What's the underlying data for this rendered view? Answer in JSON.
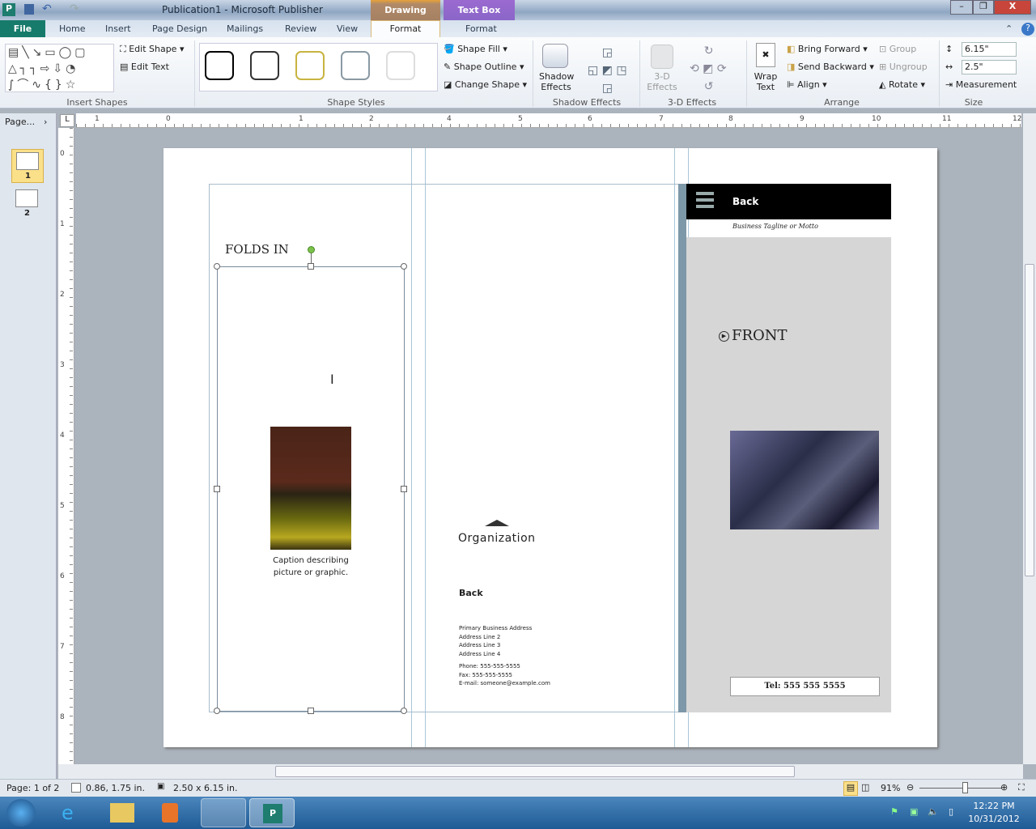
{
  "window": {
    "title": "Publication1  -  Microsoft Publisher"
  },
  "tabs": {
    "file": "File",
    "items": [
      "Home",
      "Insert",
      "Page Design",
      "Mailings",
      "Review",
      "View"
    ],
    "drawing_tools": "Drawing Tools",
    "drawing_format": "Format",
    "textbox_tools": "Text Box Tools",
    "textbox_format": "Format"
  },
  "ribbon": {
    "insert_shapes": {
      "label": "Insert Shapes",
      "edit_shape": "Edit Shape",
      "edit_text": "Edit Text"
    },
    "shape_styles": {
      "label": "Shape Styles",
      "fill": "Shape Fill",
      "outline": "Shape Outline",
      "change": "Change Shape",
      "colors": [
        "#000000",
        "#333333",
        "#c8b440",
        "#8a9aa4",
        "#dddddd"
      ]
    },
    "shadow": {
      "label": "Shadow Effects",
      "button": "Shadow Effects"
    },
    "threed": {
      "label": "3-D Effects",
      "button": "3-D Effects"
    },
    "arrange": {
      "label": "Arrange",
      "wrap": "Wrap Text",
      "bring_forward": "Bring Forward",
      "send_backward": "Send Backward",
      "align": "Align",
      "group": "Group",
      "ungroup": "Ungroup",
      "rotate": "Rotate"
    },
    "size": {
      "label": "Size",
      "height": "6.15\"",
      "width": "2.5\"",
      "measurement": "Measurement"
    }
  },
  "page_nav": {
    "label": "Page...",
    "pages": [
      "1",
      "2"
    ]
  },
  "ruler": {
    "h": [
      "1",
      "0",
      "1",
      "2",
      "4",
      "5",
      "6",
      "7",
      "8",
      "9",
      "10",
      "11",
      "12"
    ],
    "v": [
      "0",
      "1",
      "2",
      "3",
      "4",
      "5",
      "6",
      "7",
      "8"
    ]
  },
  "doc": {
    "folds_in": "FOLDS IN",
    "caption": "Caption describing picture or graphic.",
    "organization": "Organization",
    "back_heading": "Back",
    "address": [
      "Primary Business Address",
      "Address Line 2",
      "Address Line 3",
      "Address Line 4"
    ],
    "contact": [
      "Phone: 555-555-5555",
      "Fax: 555-555-5555",
      "E-mail: someone@example.com"
    ],
    "panel_back": "Back",
    "tagline": "Business Tagline or Motto",
    "front": "FRONT",
    "tel": "Tel: 555 555 5555"
  },
  "status": {
    "page": "Page: 1 of 2",
    "position": "0.86, 1.75 in.",
    "size": "2.50 x 6.15 in.",
    "zoom": "91%",
    "zoom_level": 0.55
  },
  "taskbar": {
    "time": "12:22 PM",
    "date": "10/31/2012"
  }
}
